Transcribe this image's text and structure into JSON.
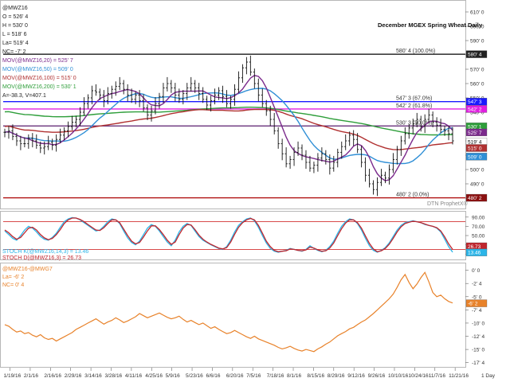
{
  "chart_data": [
    {
      "type": "candlestick",
      "title": "December MGEX Spring Wheat Daily",
      "symbol": "@MWZ16",
      "ohlc": {
        "open": "526' 4",
        "high": "530' 0",
        "low": "518' 6",
        "last": "519' 4",
        "net_change": "-7' 2"
      },
      "footer": "A=-38.3, V=407.1",
      "ylim": [
        475,
        615
      ],
      "y_ticks": [
        "610' 0",
        "600' 0",
        "590' 0",
        "580' 0",
        "570' 0",
        "560' 0",
        "550' 0",
        "540' 0",
        "530' 0",
        "520' 0",
        "510' 0",
        "500' 0",
        "490' 0",
        "480' 0"
      ],
      "x_ticks": [
        "1/19/16",
        "2/1/16",
        "2/16/16",
        "2/29/16",
        "3/14/16",
        "3/28/16",
        "4/11/16",
        "4/25/16",
        "5/9/16",
        "5/23/16",
        "6/6/16",
        "6/20/16",
        "7/5/16",
        "7/18/16",
        "8/1/16",
        "8/15/16",
        "8/29/16",
        "9/12/16",
        "9/26/16",
        "10/10/16",
        "10/24/16",
        "11/7/16",
        "11/21/16"
      ],
      "moving_averages": [
        {
          "name": "MOV(@MWZ16,20) = 525' 7",
          "color": "#7b2a8c",
          "value": 525.9
        },
        {
          "name": "MOV(@MWZ16,50) = 509' 0",
          "color": "#2f8fd6",
          "value": 509.0
        },
        {
          "name": "MOV(@MWZ16,100) = 515' 0",
          "color": "#b03030",
          "value": 515.0
        },
        {
          "name": "MOV(@MWZ16,200) = 530' 1",
          "color": "#2e9e3a",
          "value": 530.1
        }
      ],
      "retracement_levels": [
        {
          "label": "580' 4 (100.0%)",
          "value": 580.5,
          "color": "#000000"
        },
        {
          "label": "547' 3 (67.0%)",
          "value": 547.4,
          "color": "#1a1aff"
        },
        {
          "label": "542' 2 (61.8%)",
          "value": 542.25,
          "color": "#e01ee0"
        },
        {
          "label": "530' 3 (50.0%)",
          "value": 530.4,
          "color": "#5a1e6e"
        },
        {
          "label": "480' 2 (0.0%)",
          "value": 480.25,
          "color": "#b01010"
        }
      ],
      "value_tags": [
        {
          "text": "580' 4",
          "value": 580.5,
          "bg": "#222222",
          "fg": "#ffffff"
        },
        {
          "text": "547' 3",
          "value": 547.4,
          "bg": "#1a1aff",
          "fg": "#ffffff"
        },
        {
          "text": "542' 2",
          "value": 542.25,
          "bg": "#e01ee0",
          "fg": "#ffffff"
        },
        {
          "text": "530' 1",
          "value": 530.1,
          "bg": "#2e9e3a",
          "fg": "#ffffff"
        },
        {
          "text": "525' 7",
          "value": 525.9,
          "bg": "#7b2a8c",
          "fg": "#ffffff"
        },
        {
          "text": "519' 4",
          "value": 519.5,
          "bg": "#ffffff",
          "fg": "#000000"
        },
        {
          "text": "515' 0",
          "value": 515.0,
          "bg": "#b03030",
          "fg": "#ffffff"
        },
        {
          "text": "509' 0",
          "value": 509.0,
          "bg": "#2f8fd6",
          "fg": "#ffffff"
        },
        {
          "text": "480' 2",
          "value": 480.25,
          "bg": "#8b1010",
          "fg": "#ffffff"
        }
      ],
      "watermark": "DTN ProphetX®",
      "closes": [
        526,
        527,
        523,
        520,
        518,
        518,
        522,
        520,
        517,
        515,
        516,
        519,
        517,
        521,
        524,
        527,
        530,
        533,
        535,
        540,
        546,
        550,
        555,
        554,
        552,
        548,
        553,
        556,
        558,
        560,
        556,
        552,
        549,
        552,
        548,
        543,
        538,
        541,
        546,
        551,
        557,
        560,
        557,
        552,
        549,
        553,
        557,
        560,
        557,
        553,
        549,
        545,
        548,
        552,
        555,
        551,
        546,
        549,
        556,
        564,
        571,
        575,
        568,
        560,
        552,
        546,
        541,
        535,
        527,
        518,
        511,
        504,
        507,
        512,
        515,
        510,
        505,
        501,
        503,
        508,
        511,
        507,
        501,
        505,
        512,
        516,
        520,
        524,
        521,
        514,
        505,
        496,
        490,
        486,
        491,
        496,
        494,
        500,
        507,
        514,
        520,
        525,
        529,
        532,
        535,
        530,
        535,
        538,
        533,
        531,
        528,
        527,
        525,
        520
      ]
    },
    {
      "type": "line",
      "title": "Slow Stochastic",
      "series": [
        {
          "name": "STOCH K(@MWZ16,14,3) = 13.46",
          "color": "#2bb5e8",
          "values": [
            60,
            52,
            44,
            40,
            50,
            62,
            70,
            66,
            58,
            48,
            42,
            40,
            46,
            55,
            68,
            80,
            86,
            89,
            88,
            84,
            78,
            72,
            66,
            60,
            62,
            70,
            80,
            86,
            84,
            76,
            60,
            45,
            35,
            30,
            38,
            52,
            66,
            74,
            70,
            60,
            48,
            36,
            28,
            40,
            58,
            70,
            76,
            72,
            60,
            48,
            40,
            35,
            30,
            26,
            22,
            20,
            26,
            40,
            58,
            72,
            80,
            86,
            88,
            82,
            68,
            50,
            34,
            22,
            16,
            14,
            16,
            18,
            22,
            20,
            18,
            16,
            20,
            28,
            22,
            18,
            15,
            18,
            26,
            38,
            55,
            70,
            80,
            86,
            84,
            76,
            62,
            44,
            28,
            18,
            14,
            18,
            24,
            34,
            48,
            62,
            72,
            78,
            80,
            82,
            80,
            78,
            74,
            72,
            70,
            66,
            58,
            42,
            26,
            14
          ]
        },
        {
          "name": "STOCH D(@MWZ16,3) = 26.73",
          "color": "#c0262e",
          "values": [
            62,
            56,
            48,
            42,
            46,
            56,
            66,
            68,
            62,
            52,
            45,
            41,
            44,
            52,
            63,
            76,
            84,
            88,
            88,
            85,
            80,
            74,
            68,
            62,
            61,
            67,
            76,
            84,
            84,
            78,
            64,
            50,
            38,
            32,
            35,
            47,
            60,
            71,
            71,
            63,
            52,
            40,
            31,
            36,
            52,
            66,
            74,
            73,
            63,
            51,
            42,
            36,
            31,
            27,
            23,
            21,
            24,
            36,
            53,
            68,
            78,
            84,
            87,
            84,
            72,
            55,
            38,
            26,
            18,
            15,
            16,
            17,
            21,
            20,
            18,
            17,
            19,
            25,
            23,
            19,
            16,
            17,
            23,
            34,
            50,
            65,
            77,
            84,
            84,
            78,
            66,
            49,
            33,
            21,
            15,
            17,
            22,
            31,
            44,
            58,
            69,
            76,
            79,
            81,
            80,
            78,
            75,
            72,
            70,
            67,
            60,
            47,
            32,
            20
          ]
        }
      ],
      "y_ticks": [
        "90.00",
        "70.00",
        "50.00",
        "30.00",
        "10.00"
      ],
      "reference_lines": [
        {
          "value": 80,
          "color": "#d33030"
        },
        {
          "value": 20,
          "color": "#d33030"
        }
      ],
      "ylim": [
        0,
        100
      ],
      "value_tags": [
        {
          "text": "26.73",
          "value": 26.73,
          "bg": "#c0262e",
          "fg": "#ffffff"
        },
        {
          "text": "13.46",
          "value": 13.46,
          "bg": "#2bb5e8",
          "fg": "#ffffff"
        }
      ]
    },
    {
      "type": "line",
      "title": "Spread",
      "series": [
        {
          "name": "@MWZ16-@MWG7",
          "color": "#e8822a",
          "values": [
            -10.3,
            -10.6,
            -11.2,
            -11.7,
            -11.5,
            -12.0,
            -11.8,
            -12.3,
            -12.6,
            -12.2,
            -12.8,
            -13.1,
            -12.9,
            -13.4,
            -13.0,
            -12.6,
            -12.2,
            -11.8,
            -11.2,
            -10.8,
            -10.4,
            -10.0,
            -9.6,
            -9.2,
            -9.7,
            -10.2,
            -9.8,
            -9.5,
            -9.0,
            -9.4,
            -9.9,
            -9.6,
            -9.2,
            -8.8,
            -8.2,
            -8.6,
            -9.0,
            -8.7,
            -8.4,
            -8.1,
            -8.5,
            -8.9,
            -9.2,
            -9.0,
            -8.7,
            -9.3,
            -9.8,
            -9.5,
            -9.9,
            -10.3,
            -10.0,
            -10.5,
            -11.0,
            -10.7,
            -11.2,
            -11.6,
            -12.0,
            -11.8,
            -11.4,
            -11.8,
            -12.2,
            -12.6,
            -12.9,
            -12.5,
            -13.0,
            -13.3,
            -13.6,
            -13.9,
            -14.2,
            -14.6,
            -14.9,
            -14.7,
            -14.4,
            -14.8,
            -15.1,
            -15.3,
            -15.0,
            -15.2,
            -15.4,
            -14.9,
            -14.5,
            -14.0,
            -13.6,
            -13.0,
            -12.4,
            -12.0,
            -11.6,
            -11.1,
            -10.8,
            -10.3,
            -9.8,
            -9.4,
            -8.8,
            -8.2,
            -7.5,
            -6.8,
            -6.1,
            -5.4,
            -4.5,
            -3.2,
            -1.8,
            -0.8,
            -2.3,
            -3.5,
            -2.6,
            -1.4,
            -0.4,
            -2.2,
            -4.2,
            -5.0,
            -4.7,
            -5.4,
            -5.9,
            -6.2
          ]
        }
      ],
      "legend_lines": [
        "@MWZ16-@MWG7",
        "La= -6' 2",
        "NC= 0' 4"
      ],
      "y_ticks": [
        "0' 0",
        "-2' 4",
        "-5' 0",
        "-7' 4",
        "-10' 0",
        "-12' 4",
        "-15' 0",
        "-17' 4"
      ],
      "ylim": [
        -18,
        1
      ],
      "value_tags": [
        {
          "text": "-6' 2",
          "value": -6.25,
          "bg": "#e8822a",
          "fg": "#ffffff"
        }
      ],
      "x_ticks_extra": [
        "1 Day"
      ]
    }
  ],
  "price_legend": {
    "symbol": "@MWZ16",
    "open": "O = 526' 4",
    "high": "H = 530' 0",
    "low": "L = 518' 6",
    "last": "La= 519' 4",
    "net_change": "NC= -7' 2",
    "ma20": "MOV(@MWZ16,20) = 525' 7",
    "ma50": "MOV(@MWZ16,50) = 509' 0",
    "ma100": "MOV(@MWZ16,100) = 515' 0",
    "ma200": "MOV(@MWZ16,200) = 530' 1",
    "footer": "A=-38.3, V=407.1"
  },
  "stoch_legend": {
    "k": "STOCH K(@MWZ16,14,3) = 13.46",
    "d": "STOCH D(@MWZ16,3) = 26.73"
  },
  "spread_legend": {
    "title": "@MWZ16-@MWG7",
    "last": "La= -6' 2",
    "nc": "NC= 0' 4"
  }
}
